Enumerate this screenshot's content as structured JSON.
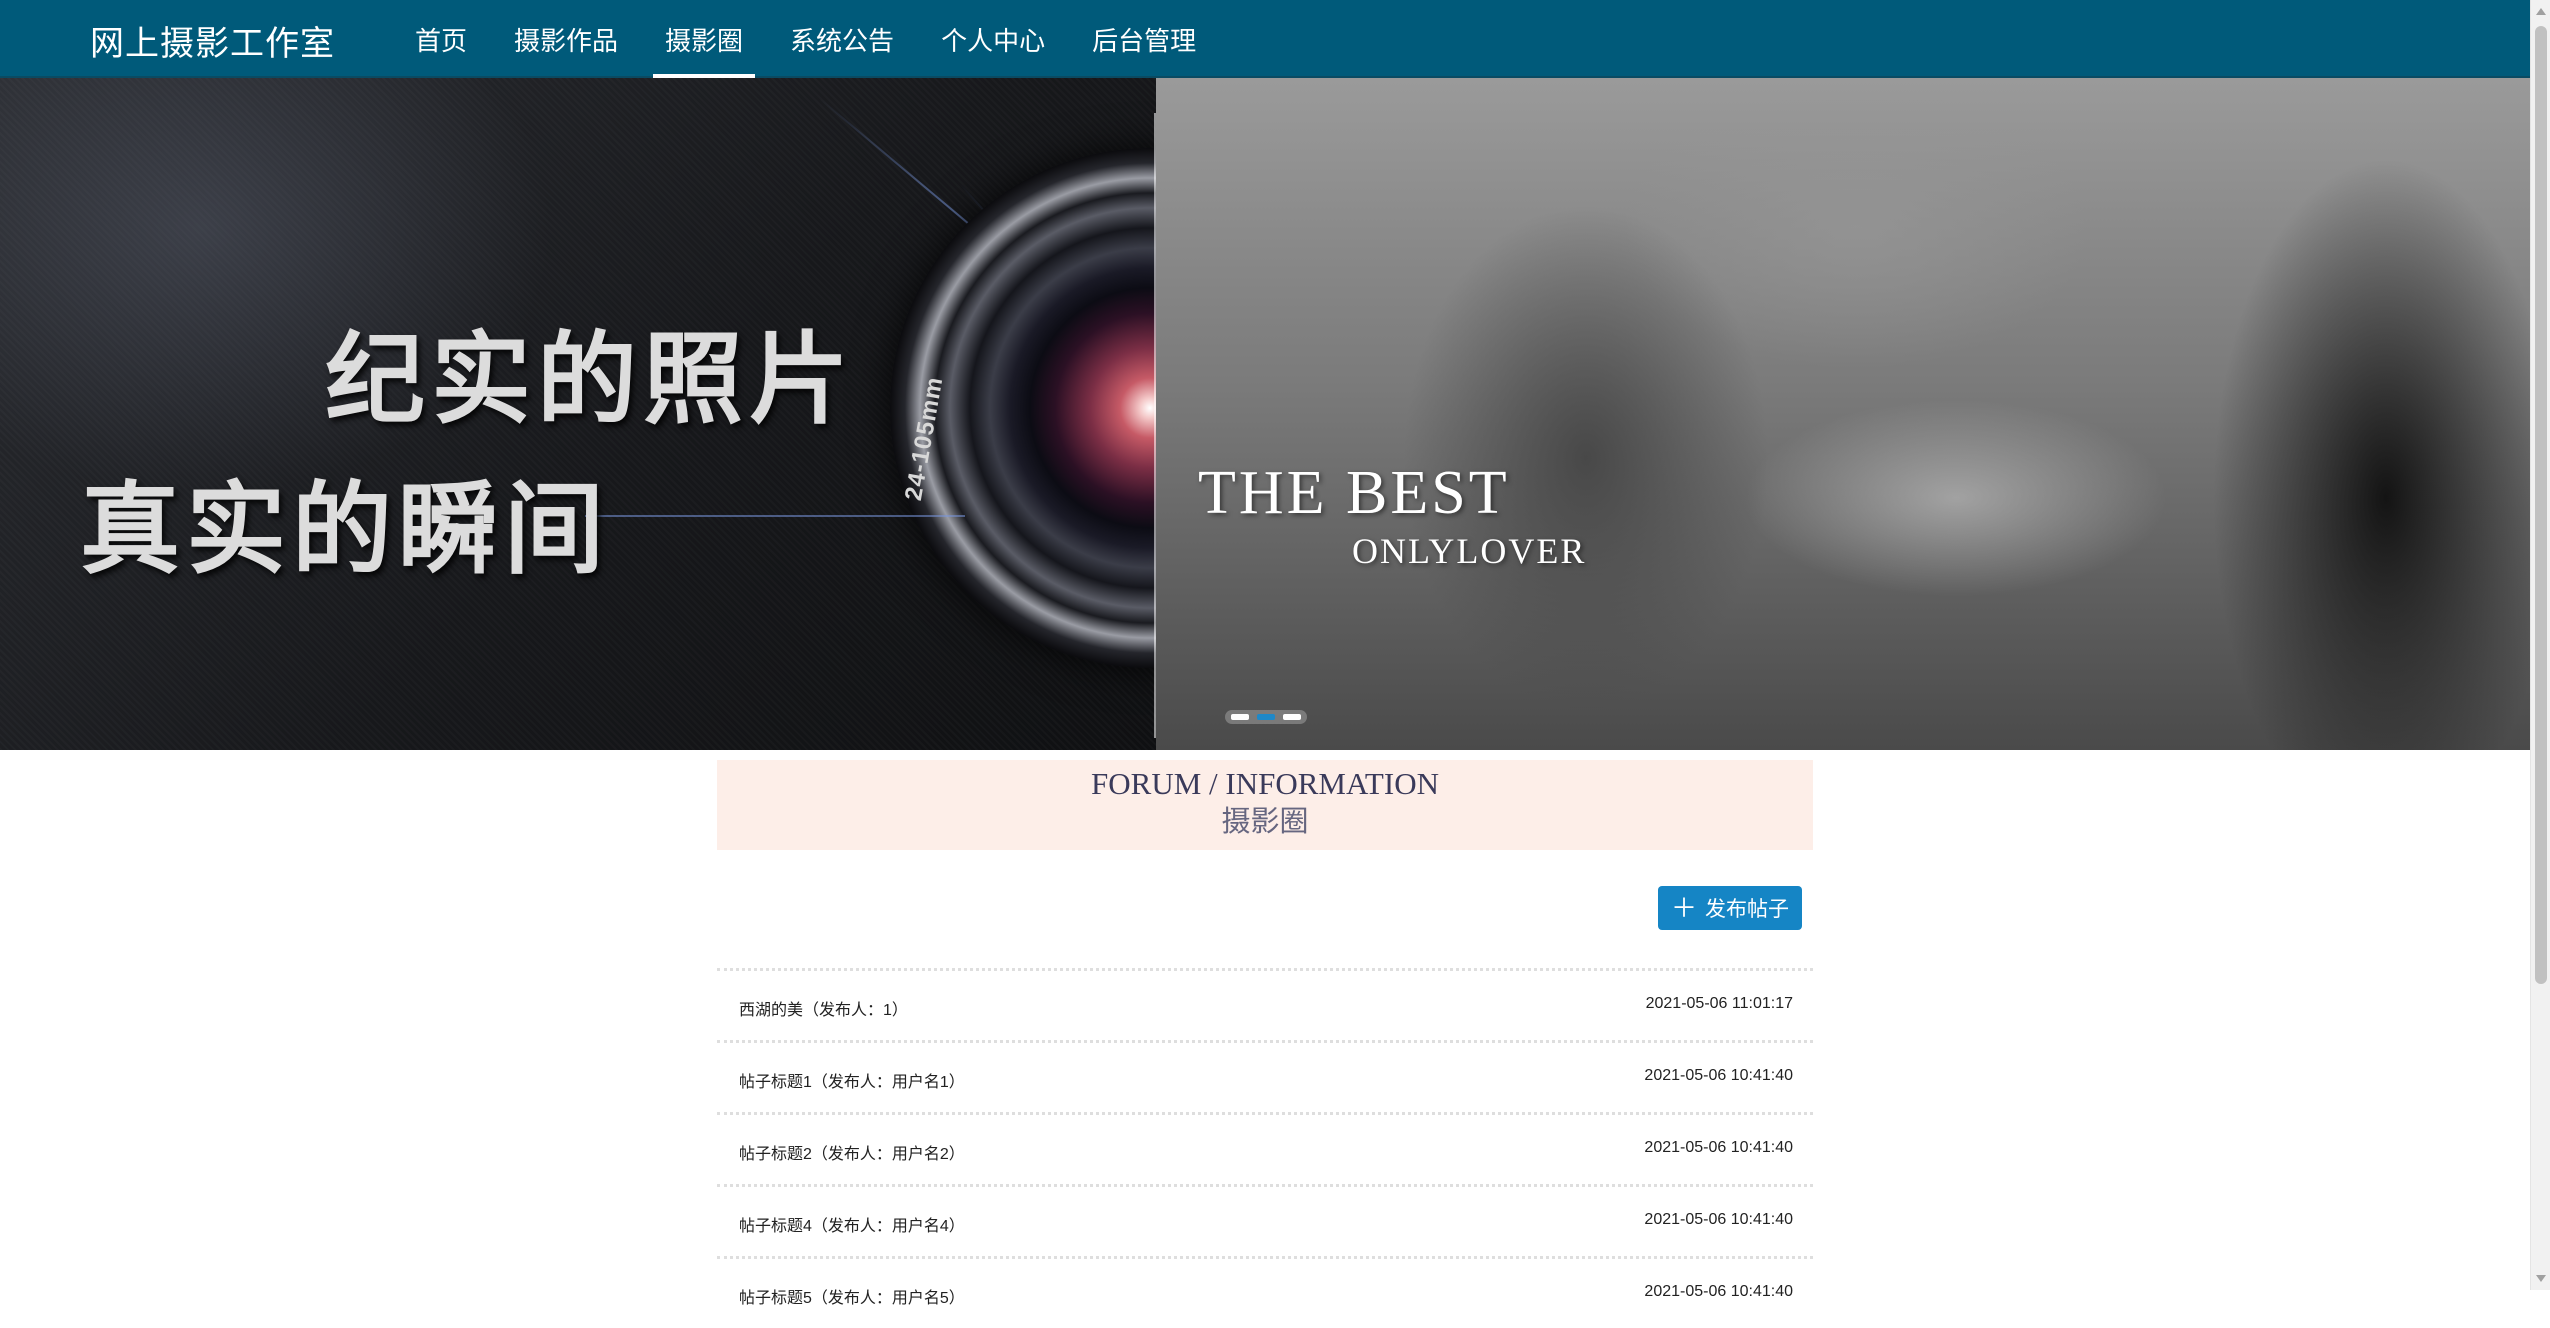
{
  "navbar": {
    "brand": "网上摄影工作室",
    "items": [
      {
        "label": "首页",
        "active": false
      },
      {
        "label": "摄影作品",
        "active": false
      },
      {
        "label": "摄影圈",
        "active": true
      },
      {
        "label": "系统公告",
        "active": false
      },
      {
        "label": "个人中心",
        "active": false
      },
      {
        "label": "后台管理",
        "active": false
      }
    ]
  },
  "banner": {
    "slogan_line1": "纪实的照片",
    "slogan_line2": "真实的瞬间",
    "lens_label": "24-105mm",
    "best_title": "THE BEST",
    "best_subtitle": "ONLYLOVER",
    "slide_count": 3,
    "active_slide": 2
  },
  "section": {
    "title_en": "FORUM / INFORMATION",
    "title_cn": "摄影圈"
  },
  "toolbar": {
    "post_button_icon": "plus-icon",
    "post_button_label": "发布帖子",
    "accent_color": "#1585c5"
  },
  "posts": [
    {
      "title": "西湖的美（发布人：1）",
      "time": "2021-05-06 11:01:17"
    },
    {
      "title": "帖子标题1（发布人：用户名1）",
      "time": "2021-05-06 10:41:40"
    },
    {
      "title": "帖子标题2（发布人：用户名2）",
      "time": "2021-05-06 10:41:40"
    },
    {
      "title": "帖子标题4（发布人：用户名4）",
      "time": "2021-05-06 10:41:40"
    },
    {
      "title": "帖子标题5（发布人：用户名5）",
      "time": "2021-05-06 10:41:40"
    }
  ],
  "colors": {
    "navbar_bg": "#005a7a",
    "section_header_bg": "#fdeee8"
  }
}
